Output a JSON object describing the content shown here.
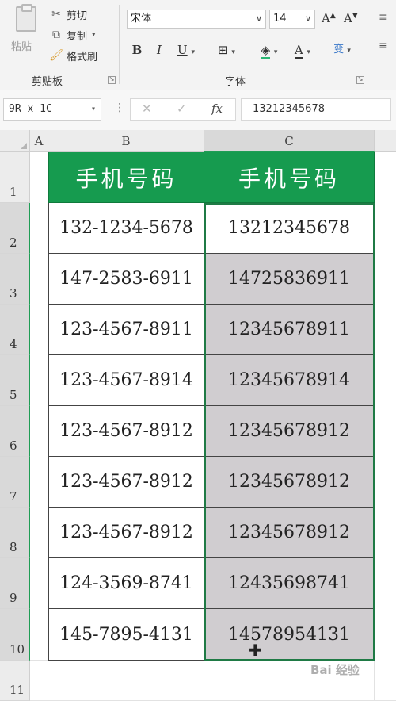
{
  "ribbon": {
    "paste_label": "粘贴",
    "cut_label": "剪切",
    "copy_label": "复制",
    "format_painter_label": "格式刷",
    "clipboard_group": "剪贴板",
    "font_group": "字体",
    "font_name": "宋体",
    "font_size": "14",
    "grow_font": "A",
    "shrink_font": "A",
    "bold": "B",
    "italic": "I",
    "underline": "U",
    "font_color": "A",
    "phonetic": "变"
  },
  "formula_bar": {
    "name_box": "9R x 1C",
    "fx_label": "fx",
    "value": "13212345678"
  },
  "columns": [
    "A",
    "B",
    "C"
  ],
  "rows": [
    "1",
    "2",
    "3",
    "4",
    "5",
    "6",
    "7",
    "8",
    "9",
    "10",
    "11"
  ],
  "table": {
    "header_b": "手机号码",
    "header_c": "手机号码",
    "col_b": [
      "132-1234-5678",
      "147-2583-6911",
      "123-4567-8911",
      "123-4567-8914",
      "123-4567-8912",
      "123-4567-8912",
      "123-4567-8912",
      "124-3569-8741",
      "145-7895-4131"
    ],
    "col_c": [
      "13212345678",
      "14725836911",
      "12345678911",
      "12345678914",
      "12345678912",
      "12345678912",
      "12345678912",
      "12435698741",
      "14578954131"
    ]
  },
  "colors": {
    "header_green": "#169b4f",
    "selection_gray": "#d0cdd0",
    "selection_border": "#1f7a45"
  },
  "watermark": "Bai 经验"
}
